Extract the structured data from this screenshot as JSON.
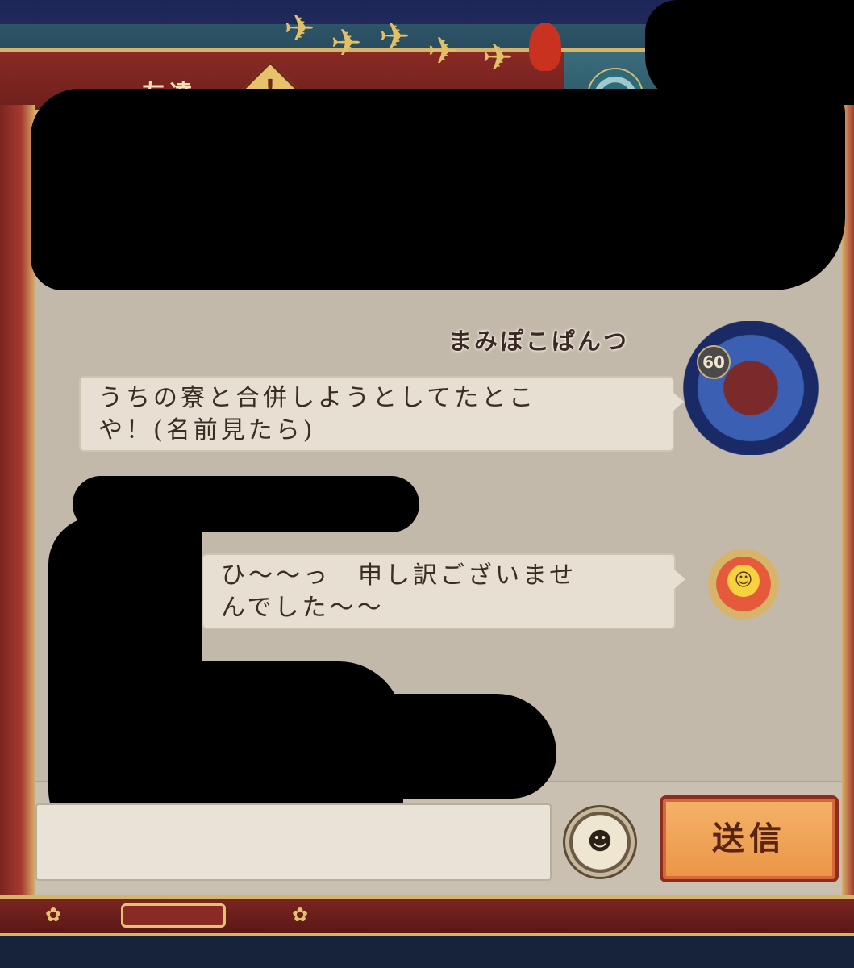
{
  "header": {
    "tab_title": "友達",
    "alert_badge": "!"
  },
  "messages": [
    {
      "sender": "まみぽこぱんつ",
      "level": "60",
      "text_line1": "うちの寮と合併しようとしてたとこ",
      "text_line2": "や！(名前見たら)",
      "avatar": "blue-flame-avatar-icon",
      "side": "right"
    },
    {
      "text_line1": "ひ〜〜っ　申し訳ございませ",
      "text_line2": "んでした〜〜",
      "avatar": "flower-avatar-icon",
      "side": "right"
    }
  ],
  "composer": {
    "input_value": "",
    "emoji_icon": "smiley-face-icon",
    "send_label": "送信"
  },
  "colors": {
    "panel_bg": "#c3b9aa",
    "bubble_bg": "#e7dfd1",
    "frame_red": "#8a2a25",
    "gold": "#d6b46a",
    "send_button": "#ea9545"
  }
}
